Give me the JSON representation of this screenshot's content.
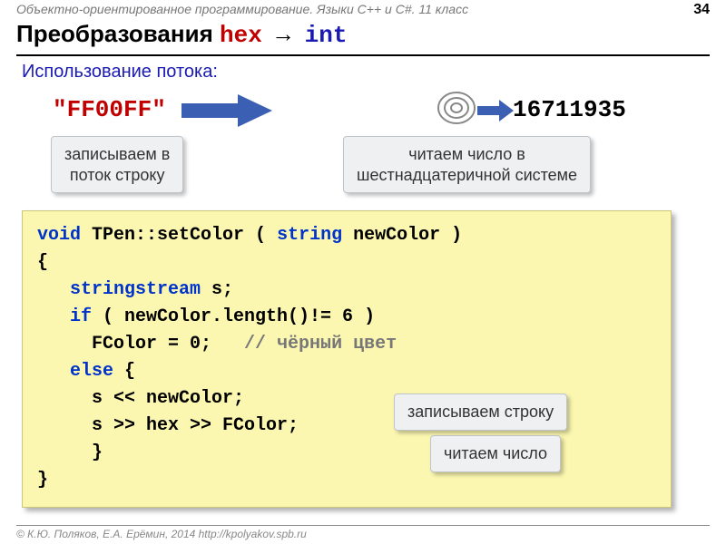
{
  "header": "Объектно-ориентированное программирование. Языки C++ и C#. 11 класс",
  "page_number": "34",
  "title": {
    "prefix": "Преобразования ",
    "hex": "hex",
    "arrow": " → ",
    "int": "int"
  },
  "subtitle": "Использование потока:",
  "hex_value": "\"FF00FF\"",
  "int_value": "16711935",
  "callouts": {
    "write_stream": "записываем в\nпоток строку",
    "read_hex": "читаем число в\nшестнадцатеричной системе",
    "write_string": "записываем строку",
    "read_number": "читаем число"
  },
  "code": {
    "l1_a": "void",
    "l1_b": " TPen::setColor ( ",
    "l1_c": "string",
    "l1_d": " newColor )",
    "l2": "{",
    "l3_a": "   stringstream",
    "l3_b": " s;",
    "l4_a": "   if",
    "l4_b": " ( newColor.length()!= 6 )",
    "l5_a": "     FColor = 0;   ",
    "l5_b": "// чёрный цвет",
    "l6_a": "   else",
    "l6_b": " {",
    "l7": "     s << newColor;",
    "l8": "     s >> hex >> FColor;",
    "l9": "     }",
    "l10": "}"
  },
  "footer": "© К.Ю. Поляков, Е.А. Ерёмин, 2014    http://kpolyakov.spb.ru"
}
